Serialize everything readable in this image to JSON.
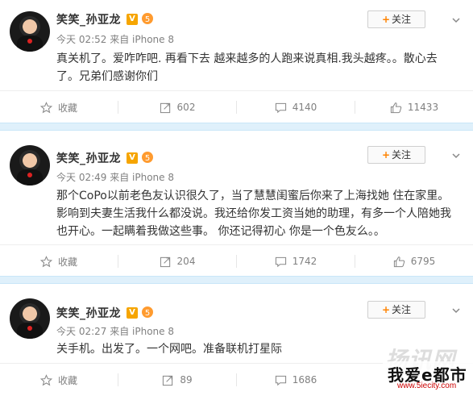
{
  "colors": {
    "accent": "#ff8200",
    "separator": "#dff0fb",
    "vip_badge": "#f6a500",
    "text_gray": "#808080"
  },
  "icons": {
    "verified": "v-badge-icon",
    "level": "level-5-icon",
    "favorite": "star-icon",
    "repost": "repost-icon",
    "comment": "comment-icon",
    "like": "thumbs-up-icon",
    "more": "chevron-down-icon"
  },
  "posts": [
    {
      "user": "笑笑_孙亚龙",
      "badge": "V",
      "level": "5",
      "time_source": "今天 02:52 来自 iPhone 8",
      "follow_label": "关注",
      "content": "真关机了。爱咋咋吧. 再看下去 越来越多的人跑来说真相.我头越疼。。散心去了。兄弟们感谢你们",
      "actions": {
        "favorite": "收藏",
        "repost": "602",
        "comment": "4140",
        "like": "11433"
      }
    },
    {
      "user": "笑笑_孙亚龙",
      "badge": "V",
      "level": "5",
      "time_source": "今天 02:49 来自 iPhone 8",
      "follow_label": "关注",
      "content": "那个CoPo以前老色友认识很久了，当了慧慧闺蜜后你来了上海找她 住在家里。影响到夫妻生活我什么都没说。我还给你发工资当她的助理，有多一个人陪她我也开心。一起瞒着我做这些事。 你还记得初心 你是一个色友么。。",
      "actions": {
        "favorite": "收藏",
        "repost": "204",
        "comment": "1742",
        "like": "6795"
      }
    },
    {
      "user": "笑笑_孙亚龙",
      "badge": "V",
      "level": "5",
      "time_source": "今天 02:27 来自 iPhone 8",
      "follow_label": "关注",
      "content": "关手机。出发了。一个网吧。准备联机打星际",
      "actions": {
        "favorite": "收藏",
        "repost": "89",
        "comment": "1686",
        "like": ""
      }
    }
  ],
  "watermark": {
    "line1": "我爱e都市",
    "line2": "www.5iecity.com",
    "faint": "扬讯网"
  }
}
